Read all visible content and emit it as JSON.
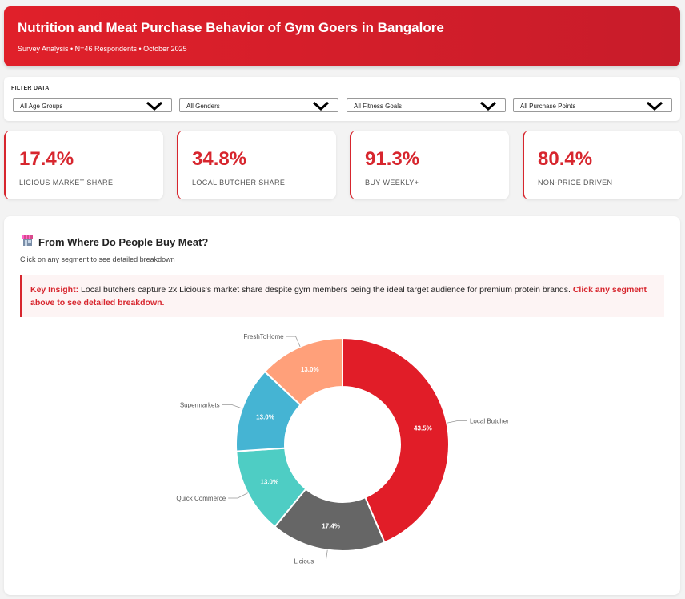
{
  "header": {
    "title": "Nutrition and Meat Purchase Behavior of Gym Goers in Bangalore",
    "subtitle": "Survey Analysis • N=46 Respondents • October 2025"
  },
  "filters": {
    "label": "FILTER DATA",
    "selects": [
      {
        "value": "All Age Groups"
      },
      {
        "value": "All Genders"
      },
      {
        "value": "All Fitness Goals"
      },
      {
        "value": "All Purchase Points"
      }
    ]
  },
  "kpis": [
    {
      "value": "17.4%",
      "label": "LICIOUS MARKET SHARE"
    },
    {
      "value": "34.8%",
      "label": "LOCAL BUTCHER SHARE"
    },
    {
      "value": "91.3%",
      "label": "BUY WEEKLY+"
    },
    {
      "value": "80.4%",
      "label": "NON-PRICE DRIVEN"
    }
  ],
  "panel": {
    "title": "From Where Do People Buy Meat?",
    "subtitle": "Click on any segment to see detailed breakdown",
    "insight": {
      "lead": "Key Insight:",
      "body": " Local butchers capture 2x Licious's market share despite gym members being the ideal target audience for premium protein brands. ",
      "cta": "Click any segment above to see detailed breakdown."
    }
  },
  "colors": {
    "accent": "#d7262e",
    "local_butcher": "#e11d28",
    "licious": "#666666",
    "quick_commerce": "#4ecdc4",
    "supermarkets": "#45b4d3",
    "freshtohome": "#ffa07a"
  },
  "chart_data": {
    "type": "pie",
    "donut": true,
    "categories": [
      "Local Butcher",
      "Licious",
      "Quick Commerce",
      "Supermarkets",
      "FreshToHome"
    ],
    "values": [
      43.5,
      17.4,
      13.0,
      13.0,
      13.0
    ],
    "data_labels": [
      "43.5%",
      "17.4%",
      "13.0%",
      "13.0%",
      "13.0%"
    ]
  }
}
